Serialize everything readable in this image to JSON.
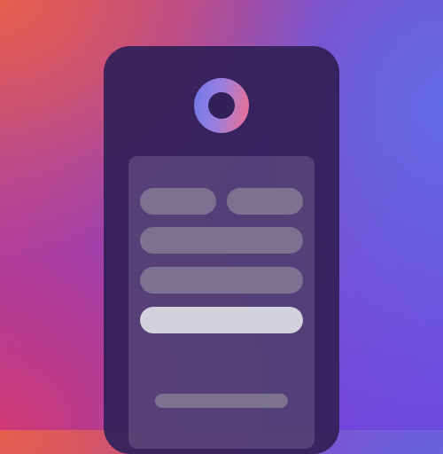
{
  "screen": {
    "logo": {
      "icon": "ring-logo-icon"
    },
    "form": {
      "fields": [
        {
          "placeholder": ""
        },
        {
          "placeholder": ""
        },
        {
          "placeholder": ""
        },
        {
          "placeholder": ""
        }
      ],
      "submit_label": "",
      "footer_link": ""
    }
  },
  "colors": {
    "background_start": "#e8604a",
    "background_end": "#6b6ef0",
    "device": "#322058",
    "field": "#7b7292",
    "button": "#d3d1da",
    "logo_gradient": [
      "#6e79e8",
      "#f2708c"
    ]
  }
}
